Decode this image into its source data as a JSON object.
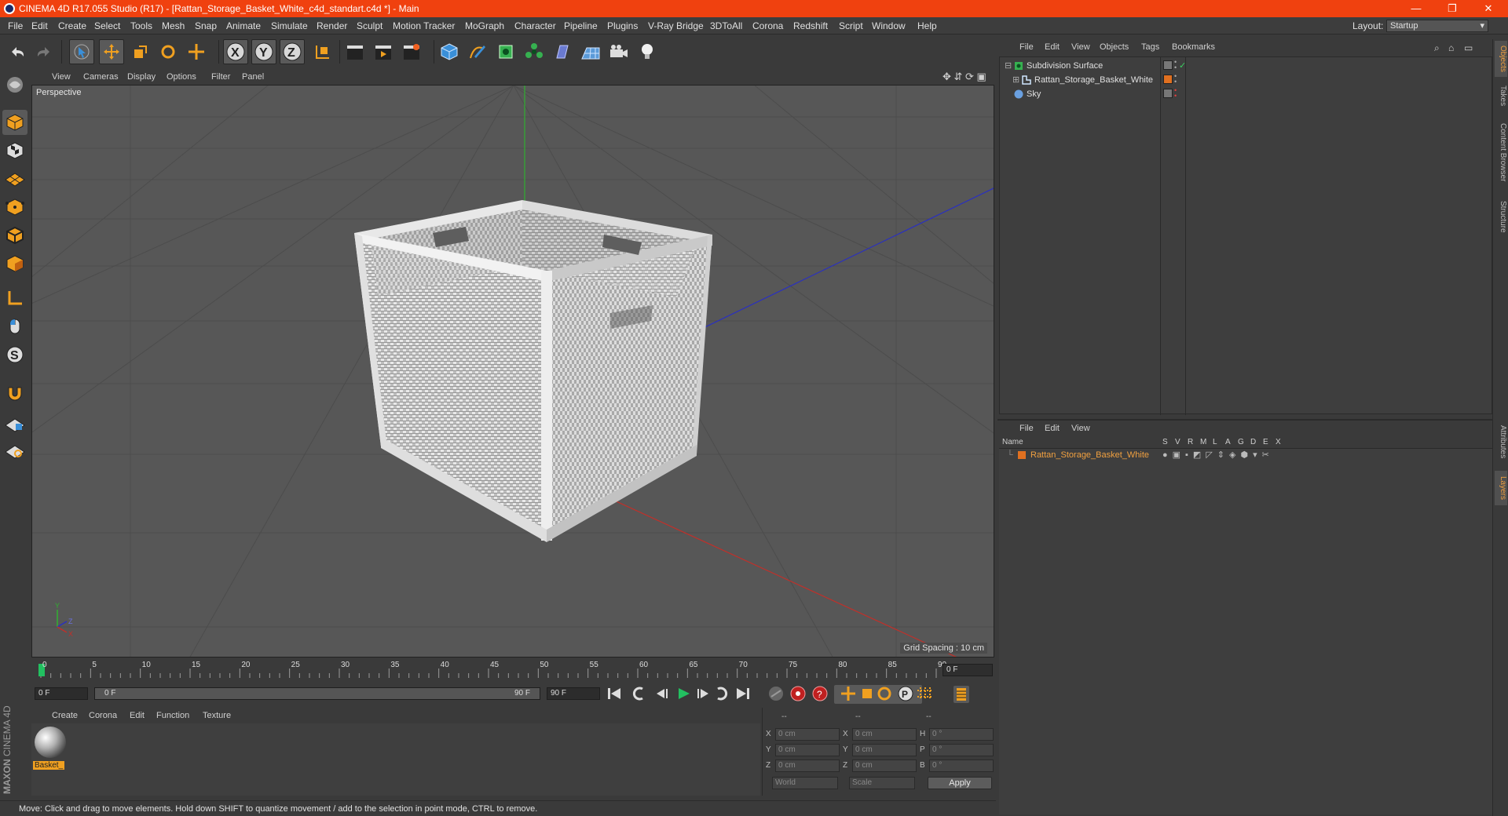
{
  "window": {
    "title": "CINEMA 4D R17.055 Studio (R17) - [Rattan_Storage_Basket_White_c4d_standart.c4d *] - Main",
    "minimize": "—",
    "restore": "❐",
    "close": "✕"
  },
  "menubar": {
    "items": [
      "File",
      "Edit",
      "Create",
      "Select",
      "Tools",
      "Mesh",
      "Snap",
      "Animate",
      "Simulate",
      "Render",
      "Sculpt",
      "Motion Tracker",
      "MoGraph",
      "Character",
      "Pipeline",
      "Plugins",
      "V-Ray Bridge",
      "3DToAll",
      "Corona",
      "Redshift",
      "Script",
      "Window",
      "Help"
    ],
    "layout_label": "Layout:",
    "layout_value": "Startup"
  },
  "viewport": {
    "menu": [
      "View",
      "Cameras",
      "Display",
      "Options",
      "Filter",
      "Panel"
    ],
    "label": "Perspective",
    "grid_spacing": "Grid Spacing : 10 cm",
    "axis_labels": {
      "y": "Y",
      "z": "Z",
      "x": "X"
    }
  },
  "timeline": {
    "ticks": [
      "0",
      "5",
      "10",
      "15",
      "20",
      "25",
      "30",
      "35",
      "40",
      "45",
      "50",
      "55",
      "60",
      "65",
      "70",
      "75",
      "80",
      "85",
      "90"
    ],
    "current_frame": "0 F",
    "start_field": "0 F",
    "range_start": "0 F",
    "range_end": "90 F",
    "end_field": "90 F"
  },
  "material_panel": {
    "menu": [
      "Create",
      "Corona",
      "Edit",
      "Function",
      "Texture"
    ],
    "materials": [
      {
        "name": "Basket_"
      }
    ]
  },
  "coords": {
    "headers": [
      "--",
      "--",
      "--"
    ],
    "rows": [
      {
        "a": "X",
        "av": "0 cm",
        "b": "X",
        "bv": "0 cm",
        "c": "H",
        "cv": "0 °"
      },
      {
        "a": "Y",
        "av": "0 cm",
        "b": "Y",
        "bv": "0 cm",
        "c": "P",
        "cv": "0 °"
      },
      {
        "a": "Z",
        "av": "0 cm",
        "b": "Z",
        "bv": "0 cm",
        "c": "B",
        "cv": "0 °"
      }
    ],
    "mode1": "World",
    "mode2": "Scale",
    "apply": "Apply"
  },
  "status": "Move: Click and drag to move elements. Hold down SHIFT to quantize movement / add to the selection in point mode, CTRL to remove.",
  "object_manager": {
    "menu": [
      "File",
      "Edit",
      "View",
      "Objects",
      "Tags",
      "Bookmarks"
    ],
    "objects": [
      {
        "name": "Subdivision Surface"
      },
      {
        "name": "Rattan_Storage_Basket_White"
      },
      {
        "name": "Sky"
      }
    ]
  },
  "layer_manager": {
    "menu": [
      "File",
      "Edit",
      "View"
    ],
    "columns": [
      "Name",
      "S",
      "V",
      "R",
      "M",
      "L",
      "A",
      "G",
      "D",
      "E",
      "X"
    ],
    "layers": [
      {
        "name": "Rattan_Storage_Basket_White",
        "color": "#e07020"
      }
    ]
  },
  "side_tabs": [
    "Objects",
    "Takes",
    "Content Browser",
    "Structure",
    "Attributes",
    "Layers"
  ],
  "maxon": {
    "brand": "MAXON",
    "product": "CINEMA 4D"
  },
  "colors": {
    "title_bar": "#f0410f",
    "accent": "#f0a040",
    "axis_x": "#c0302a",
    "axis_y": "#30b030",
    "axis_z": "#2a30c0"
  }
}
